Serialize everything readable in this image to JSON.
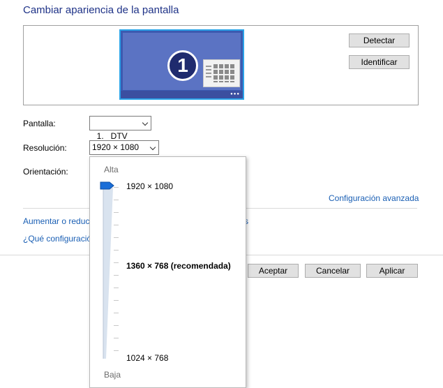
{
  "header": {
    "title": "Cambiar apariencia de la pantalla"
  },
  "preview": {
    "monitor_number": "1",
    "detect_label": "Detectar",
    "identify_label": "Identificar"
  },
  "form": {
    "display_label": "Pantalla:",
    "display_value": "1.   DTV",
    "resolution_label": "Resolución:",
    "resolution_value": "1920 × 1080",
    "orientation_label": "Orientación:"
  },
  "links": {
    "advanced": "Configuración avanzada",
    "enlarge": "Aumentar o reduc",
    "enlarge_tail": "s",
    "which_settings": "¿Qué configuració"
  },
  "buttons": {
    "accept": "Aceptar",
    "cancel": "Cancelar",
    "apply": "Aplicar"
  },
  "resolution_slider": {
    "high_label": "Alta",
    "low_label": "Baja",
    "top_value": "1920 × 1080",
    "recommended": "1360 × 768 (recomendada)",
    "bottom_value": "1024 × 768",
    "selected_level": 1.0
  }
}
